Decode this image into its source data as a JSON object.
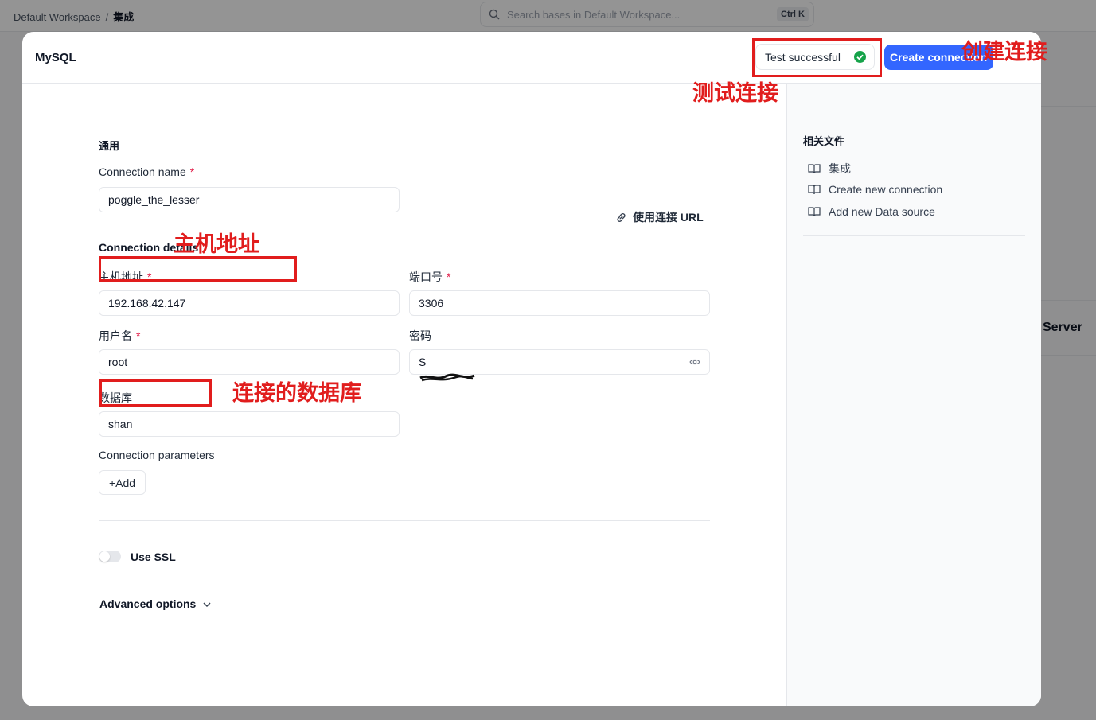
{
  "background": {
    "breadcrumb": {
      "workspace": "Default Workspace",
      "separator": "/",
      "current": "集成"
    },
    "search": {
      "placeholder": "Search bases in Default Workspace...",
      "shortcut": "Ctrl K"
    },
    "partial_label": "Server"
  },
  "modal": {
    "title": "MySQL",
    "test_button": {
      "label": "Test successful",
      "status_color": "#16a34a"
    },
    "create_button": {
      "label": "Create connection",
      "color": "#3366ff"
    },
    "form": {
      "section_general": "通用",
      "connection_name": {
        "label": "Connection name",
        "required_mark": "*",
        "value": "poggle_the_lesser"
      },
      "section_details": "Connection details",
      "use_url_link": "使用连接 URL",
      "host": {
        "label": "主机地址",
        "required_mark": "*",
        "value": "192.168.42.147"
      },
      "port": {
        "label": "端口号",
        "required_mark": "*",
        "value": "3306"
      },
      "username": {
        "label": "用户名",
        "required_mark": "*",
        "value": "root"
      },
      "password": {
        "label": "密码",
        "value": "S"
      },
      "database": {
        "label": "数据库",
        "value": "shan"
      },
      "params": {
        "label": "Connection parameters",
        "add_label": "Add"
      },
      "ssl": {
        "label": "Use SSL",
        "enabled": false
      },
      "advanced": "Advanced options"
    },
    "sidebar": {
      "title": "相关文件",
      "items": [
        {
          "label": "集成",
          "icon": "book-open-icon"
        },
        {
          "label": "Create new connection",
          "icon": "book-open-icon"
        },
        {
          "label": "Add new Data source",
          "icon": "book-open-icon"
        }
      ]
    }
  },
  "annotations": {
    "create": "创建连接",
    "test": "测试连接",
    "host": "主机地址",
    "database": "连接的数据库",
    "color": "#e11d1d"
  }
}
